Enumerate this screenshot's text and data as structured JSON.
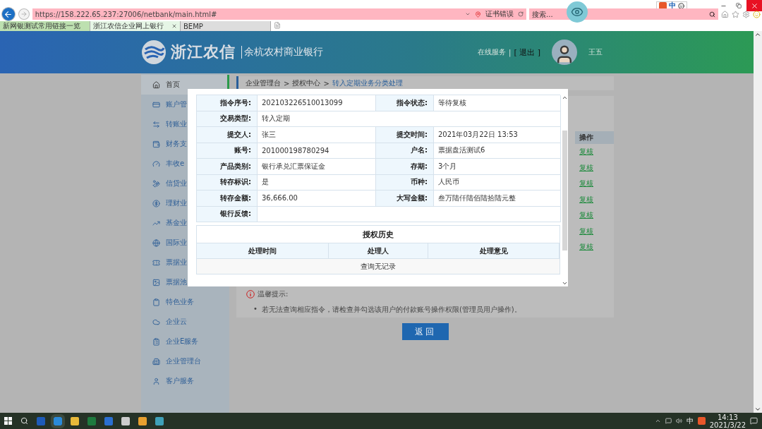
{
  "browser": {
    "address": "https://158.222.65.237:27006/netbank/main.html#",
    "cert_warning": "证书错误",
    "search": {
      "placeholder": "搜索..."
    },
    "ime": "中",
    "tabs": [
      {
        "label": "新网银测试常用链接一览",
        "selected": false
      },
      {
        "label": "浙江农信企业网上银行",
        "selected": true
      },
      {
        "label": "BEMP",
        "selected": false
      }
    ]
  },
  "header": {
    "brand": "浙江农信",
    "subbrand": "余杭农村商业银行",
    "online_service": "在线服务",
    "separator": "|",
    "logout": "[ 退出 ]",
    "user": "王五"
  },
  "sidebar": {
    "items": [
      {
        "label": "首页",
        "selected": true
      },
      {
        "label": "账户管",
        "selected": false
      },
      {
        "label": "转账业",
        "selected": false
      },
      {
        "label": "财务支",
        "selected": false
      },
      {
        "label": "丰收e",
        "selected": false
      },
      {
        "label": "信贷业",
        "selected": false
      },
      {
        "label": "理财业",
        "selected": false
      },
      {
        "label": "基金业",
        "selected": false
      },
      {
        "label": "国际业",
        "selected": false
      },
      {
        "label": "票据业",
        "selected": false
      },
      {
        "label": "票据池",
        "selected": false
      },
      {
        "label": "特色业务",
        "selected": false
      },
      {
        "label": "企业云",
        "selected": false
      },
      {
        "label": "企业E服务",
        "selected": false
      },
      {
        "label": "企业管理台",
        "selected": false
      },
      {
        "label": "客户服务",
        "selected": false
      }
    ]
  },
  "breadcrumb": {
    "separator": ">",
    "items": [
      "企业管理台",
      "授权中心",
      "转入定期业务分类处理"
    ]
  },
  "list": {
    "column": "操作",
    "actions": [
      "复核",
      "复核",
      "复核",
      "复核",
      "复核",
      "复核",
      "复核"
    ]
  },
  "tips": {
    "title": "温馨提示:",
    "bullet": "•",
    "items": [
      "若无法查询相应指令，请检查并勾选该用户的付款账号操作权限(管理员用户操作)。"
    ]
  },
  "return_button": "返回",
  "modal": {
    "details": [
      {
        "cells": [
          {
            "label": "指令序号:",
            "value": "202103226510013099"
          },
          {
            "label": "指令状态:",
            "value": "等待复核"
          }
        ]
      },
      {
        "cells": [
          {
            "label": "交易类型:",
            "value": "转入定期"
          }
        ]
      },
      {
        "cells": [
          {
            "label": "提交人:",
            "value": "张三"
          },
          {
            "label": "提交时间:",
            "value": "2021年03月22日 13:53"
          }
        ]
      },
      {
        "cells": [
          {
            "label": "账号:",
            "value": "201000198780294"
          },
          {
            "label": "户名:",
            "value": "票据盘活测试6"
          }
        ]
      },
      {
        "cells": [
          {
            "label": "产品类别:",
            "value": "银行承兑汇票保证金"
          },
          {
            "label": "存期:",
            "value": "3个月"
          }
        ]
      },
      {
        "cells": [
          {
            "label": "转存标识:",
            "value": "是"
          },
          {
            "label": "币种:",
            "value": "人民币"
          }
        ]
      },
      {
        "cells": [
          {
            "label": "转存金额:",
            "value": "36,666.00"
          },
          {
            "label": "大写金额:",
            "value": "叁万陆仟陆佰陆拾陆元整"
          }
        ]
      },
      {
        "cells": [
          {
            "label": "银行反馈:"
          }
        ]
      }
    ],
    "history": {
      "title": "授权历史",
      "columns": [
        "处理时间",
        "处理人",
        "处理意见"
      ],
      "empty": "查询无记录"
    }
  },
  "taskbar": {
    "ime": "中",
    "time": "14:13",
    "date": "2021/3/22"
  }
}
